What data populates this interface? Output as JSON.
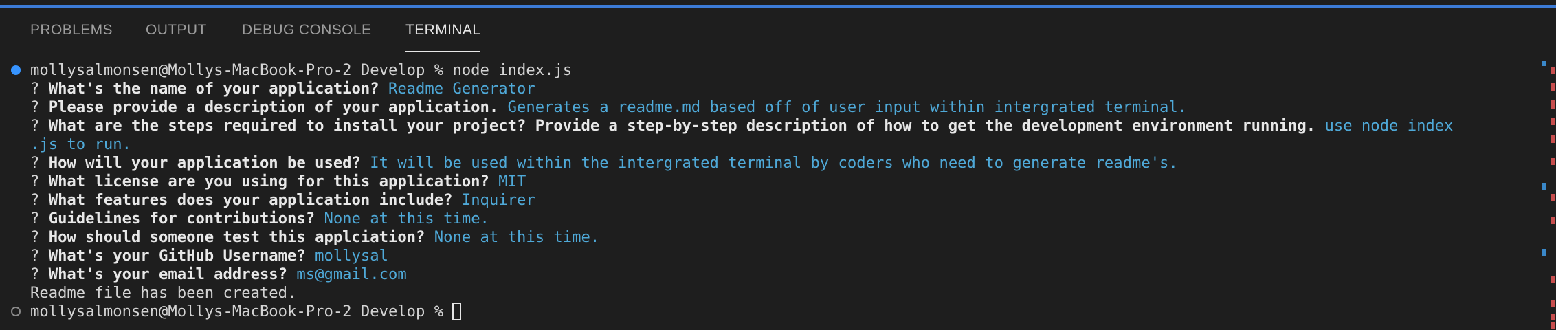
{
  "tabs": [
    {
      "label": "PROBLEMS",
      "active": false
    },
    {
      "label": "OUTPUT",
      "active": false
    },
    {
      "label": "DEBUG CONSOLE",
      "active": false
    },
    {
      "label": "TERMINAL",
      "active": true
    }
  ],
  "terminal": {
    "prompt": "mollysalmonsen@Mollys-MacBook-Pro-2 Develop % ",
    "command": "node index.js",
    "qa": [
      {
        "q": "What's the name of your application?",
        "a": "Readme Generator"
      },
      {
        "q": "Please provide a description of your application.",
        "a": "Generates a readme.md based off of user input within intergrated terminal."
      },
      {
        "q": "What are the steps required to install your project? Provide a step-by-step description of how to get the development environment running.",
        "a": "use node index",
        "a_cont": ".js to run."
      },
      {
        "q": "How will your application be used?",
        "a": "It will be used within the intergrated terminal by coders who need to generate readme's."
      },
      {
        "q": "What license are you using for this application?",
        "a": "MIT"
      },
      {
        "q": "What features does your application include?",
        "a": "Inquirer"
      },
      {
        "q": "Guidelines for contributions?",
        "a": "None at this time."
      },
      {
        "q": "How should someone test this applciation?",
        "a": "None at this time."
      },
      {
        "q": "What's your GitHub Username?",
        "a": "mollysal"
      },
      {
        "q": "What's your email address?",
        "a": "ms@gmail.com"
      }
    ],
    "result": "Readme file has been created.",
    "prompt2": "mollysalmonsen@Mollys-MacBook-Pro-2 Develop % "
  },
  "colors": {
    "answer": "#4fa9d8",
    "accent": "#3794ff",
    "background": "#1e1e1e"
  }
}
